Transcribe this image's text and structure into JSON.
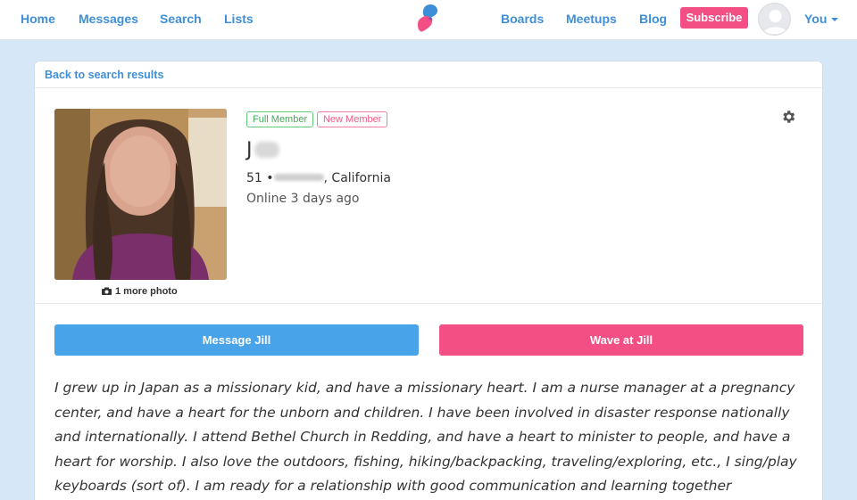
{
  "nav": {
    "home": "Home",
    "messages": "Messages",
    "search": "Search",
    "lists": "Lists",
    "boards": "Boards",
    "meetups": "Meetups",
    "blog": "Blog",
    "subscribe": "Subscribe",
    "you": "You"
  },
  "colors": {
    "link": "#3f8fd8",
    "brand_pink": "#f44f85",
    "message_blue": "#49a3e9",
    "page_bg": "#d6e8f7"
  },
  "profile": {
    "back_link": "Back to search results",
    "badges": [
      "Full Member",
      "New Member"
    ],
    "name_initial": "J",
    "age": "51 •",
    "state": ", California",
    "online": "Online 3 days ago",
    "more_photo": "1 more photo",
    "message_button": "Message Jill",
    "wave_button": "Wave at Jill",
    "bio": "I grew up in Japan as a missionary kid, and have a missionary heart. I am a nurse manager at a pregnancy center, and have a heart for the unborn and children. I have been involved in disaster response nationally and internationally. I attend Bethel Church in Redding, and have a heart to minister to people, and have a heart for worship. I also love the outdoors, fishing, hiking/backpacking, traveling/exploring, etc., I sing/play keyboards (sort of). I am ready for a relationship with good communication and learning together"
  }
}
